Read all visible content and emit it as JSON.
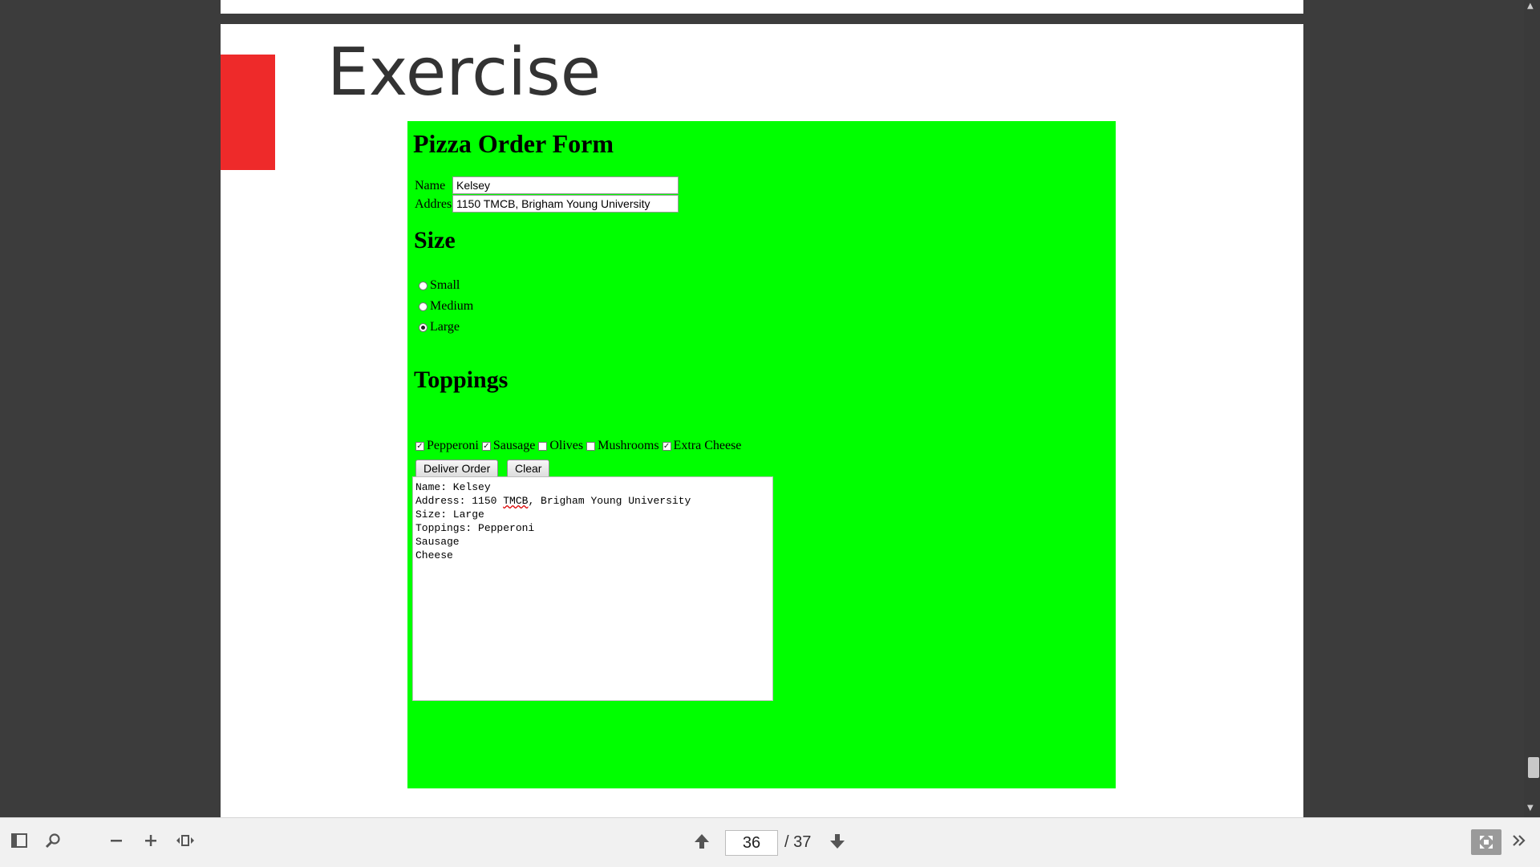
{
  "slide": {
    "title": "Exercise"
  },
  "form": {
    "heading": "Pizza Order Form",
    "name_label": "Name",
    "name_value": "Kelsey",
    "address_label": "Address",
    "address_value": "1150 TMCB, Brigham Young University",
    "size_heading": "Size",
    "sizes": [
      {
        "label": "Small",
        "checked": false
      },
      {
        "label": "Medium",
        "checked": false
      },
      {
        "label": "Large",
        "checked": true
      }
    ],
    "toppings_heading": "Toppings",
    "toppings": [
      {
        "label": "Pepperoni",
        "checked": true
      },
      {
        "label": "Sausage",
        "checked": true
      },
      {
        "label": "Olives",
        "checked": false
      },
      {
        "label": "Mushrooms",
        "checked": false
      },
      {
        "label": "Extra Cheese",
        "checked": true
      }
    ],
    "deliver_label": "Deliver Order",
    "clear_label": "Clear",
    "output_lines": [
      "Name: Kelsey",
      "Address: 1150 TMCB, Brigham Young University",
      "Size: Large",
      "Toppings: Pepperoni",
      "Sausage",
      "Cheese"
    ]
  },
  "toolbar": {
    "current_page": "36",
    "total_pages": "/ 37"
  },
  "icons": {
    "sidebar": "sidebar-icon",
    "search": "search-icon",
    "zoom_out": "minus-icon",
    "zoom_in": "plus-icon",
    "fit": "fit-width-icon",
    "prev": "arrow-up-icon",
    "next": "arrow-down-icon",
    "fullscreen": "fullscreen-icon",
    "more": "chevron-double-right-icon"
  }
}
